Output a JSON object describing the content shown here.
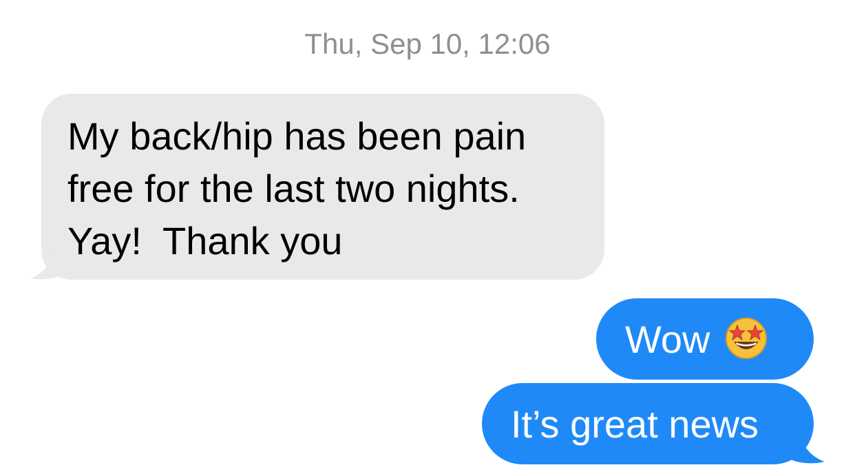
{
  "conversation": {
    "timestamp": "Thu, Sep 10, 12:06",
    "messages": [
      {
        "direction": "incoming",
        "text": "My back/hip has been pain free for the last two nights. Yay!  Thank you"
      },
      {
        "direction": "outgoing",
        "text": "Wow",
        "emoji": "star-struck-emoji"
      },
      {
        "direction": "outgoing",
        "text": "It’s great news"
      }
    ]
  },
  "colors": {
    "background": "#ffffff",
    "incoming_bubble": "#e9e9eb",
    "outgoing_bubble": "#1f8af7",
    "timestamp_text": "#8e8e93"
  }
}
